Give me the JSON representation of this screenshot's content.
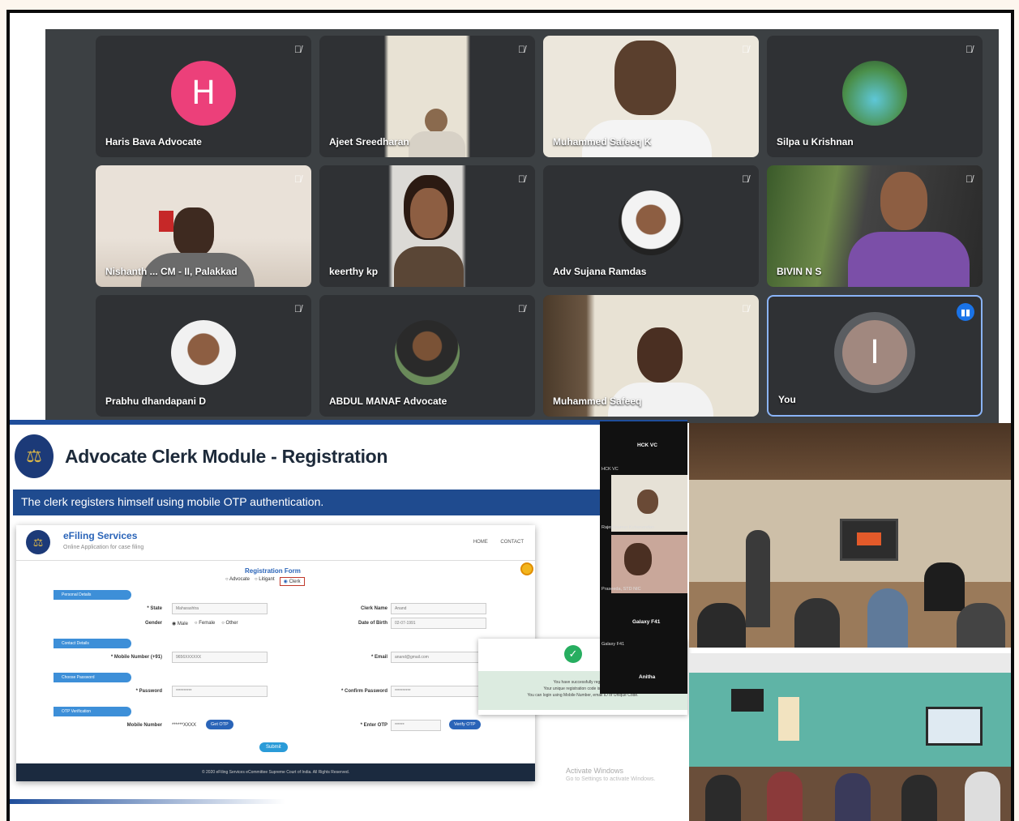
{
  "meeting": {
    "participants": [
      {
        "name": "Haris Bava Advocate",
        "initial": "H",
        "kind": "initial",
        "color": "#ec407a",
        "muted": true
      },
      {
        "name": "Ajeet Sreedharan",
        "kind": "video",
        "muted": true
      },
      {
        "name": "Muhammed Safeeq K",
        "kind": "video",
        "muted": true
      },
      {
        "name": "Silpa u Krishnan",
        "kind": "photo",
        "muted": true
      },
      {
        "name": "Nishanth ... CM - II, Palakkad",
        "kind": "video",
        "muted": true
      },
      {
        "name": "keerthy kp",
        "kind": "video",
        "muted": true
      },
      {
        "name": "Adv Sujana Ramdas",
        "kind": "photo",
        "muted": true
      },
      {
        "name": "BIVIN N S",
        "kind": "video",
        "muted": true
      },
      {
        "name": "Prabhu dhandapani D",
        "kind": "photo",
        "muted": true
      },
      {
        "name": "ABDUL MANAF Advocate",
        "kind": "photo",
        "muted": true
      },
      {
        "name": "Muhammed Safeeq",
        "kind": "video",
        "muted": true
      },
      {
        "name": "You",
        "initial": "I",
        "kind": "initial",
        "color": "#a1887f",
        "speaking": true
      }
    ]
  },
  "slide": {
    "title": "Advocate Clerk Module - Registration",
    "banner": "The clerk registers himself using mobile OTP authentication.",
    "efiling": {
      "brand": "eFiling Services",
      "tagline": "Online Application for case filing",
      "nav": "HOME CONTACT",
      "form_title": "Registration Form",
      "roles": [
        "Advocate",
        "Litigant",
        "Clerk"
      ],
      "sections": {
        "personal": "Personal Details",
        "contact": "Contact Details",
        "password": "Choose Password",
        "otp": "OTP Verification"
      },
      "labels": {
        "state": "* State",
        "clerk_name": "Clerk Name",
        "gender": "Gender",
        "dob": "Date of Birth",
        "mobile": "* Mobile Number (+91)",
        "email": "* Email",
        "password": "* Password",
        "confirm": "* Confirm Password",
        "mobile_otp": "Mobile Number",
        "enter_otp": "* Enter OTP"
      },
      "values": {
        "state": "Maharashtra",
        "clerk_name": "Anand",
        "gender_options": [
          "Male",
          "Female",
          "Other"
        ],
        "dob": "02-07-1991",
        "mobile": "9656XXXXXX",
        "email": "anand@gmail.com",
        "password": "**********",
        "confirm": "**********",
        "mobile_masked": "******XXXX",
        "otp": "******"
      },
      "buttons": {
        "get_otp": "Get OTP",
        "verify_otp": "Verify OTP",
        "submit": "Submit"
      },
      "footer": "© 2020 eFiling Services eCommittee Supreme Court of India. All Rights Reserved."
    },
    "success": {
      "line1": "You have successfully registered",
      "line2": "Your unique registration code is CL... Anitha",
      "line3": "You can login using Mobile Number, email ID or Unique Code."
    },
    "watermark": {
      "line1": "Activate Windows",
      "line2": "Go to Settings to activate Windows."
    }
  },
  "side_strip": {
    "items": [
      "HCK VC",
      "HCK VC",
      "Rajeshkumar Kuhanandan",
      "Praseeda, STD NIC",
      "Galaxy F41",
      "Galaxy F41",
      "Anitha"
    ]
  }
}
